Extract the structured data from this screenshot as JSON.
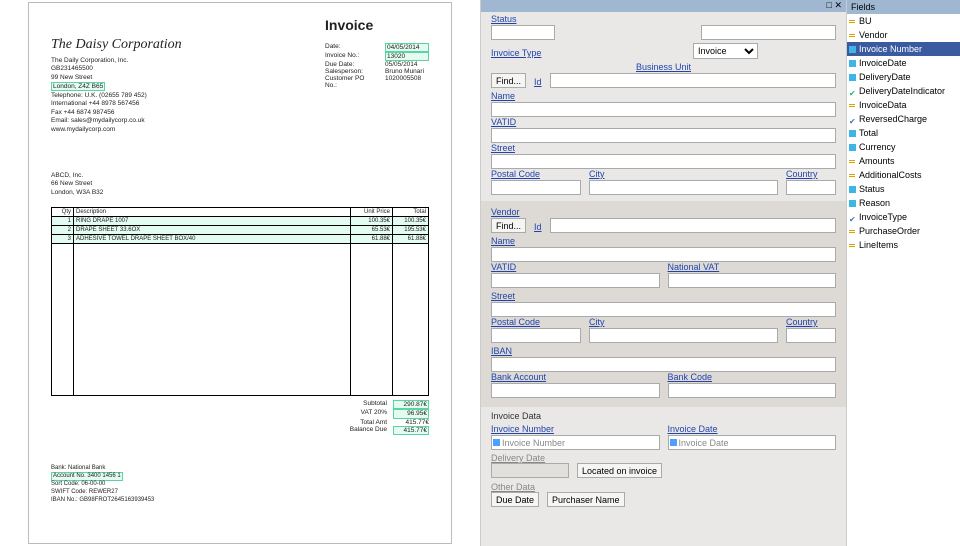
{
  "window": {
    "maximize": "□",
    "close": "✕"
  },
  "invoice": {
    "title": "Invoice",
    "corp": "The Daisy Corporation",
    "meta": {
      "date_lbl": "Date:",
      "date": "04/05/2014",
      "invno_lbl": "Invoice No.:",
      "invno": "13020",
      "due_lbl": "Due Date:",
      "due": "05/05/2014",
      "sales_lbl": "Salesperson:",
      "sales": "Bruno Munari",
      "po_lbl": "Customer PO No.:",
      "po": "1020005508"
    },
    "seller": {
      "name": "The Daily Corporation, Inc.",
      "n1": "GB231465500",
      "addr": "99 New Street",
      "city": "London, Z4Z B65",
      "tel": "Telephone: U.K. (02655 789 452)",
      "intl": "International +44 8978 567456",
      "fax": "Fax +44 6874 987456",
      "email": "Email: sales@mydailycorp.co.uk",
      "web": "www.mydailycorp.com"
    },
    "buyer": {
      "name": "ABCD, Inc.",
      "addr": "66 New Street",
      "city": "London, W3A B32"
    },
    "th": {
      "qty": "Qty",
      "desc": "Description",
      "up": "Unit Price",
      "tot": "Total"
    },
    "items": [
      {
        "q": "1",
        "d": "RING DRAPE 1007",
        "p": "100.35€",
        "t": "100.35€"
      },
      {
        "q": "2",
        "d": "DRAPE SHEET 33.6OX",
        "p": "65.53€",
        "t": "195.53€"
      },
      {
        "q": "3",
        "d": "ADHESIVE TOWEL DRAPE SHEET BOX/40",
        "p": "61.88€",
        "t": "61.88€"
      }
    ],
    "totals": {
      "subtotal_lbl": "Subtotal",
      "subtotal": "290.87€",
      "vat_lbl": "VAT 20%",
      "vat": "96.95€",
      "total_lbl": "Total Amt",
      "total": "415.77€",
      "bal_lbl": "Balance Due",
      "bal": "415.77€"
    },
    "bank": {
      "l1": "Bank: National Bank",
      "l2": "Account No. 3400 1456 1",
      "l3": "Sort Code: 06-00-00",
      "l4": "SWIFT Code: REWER27",
      "l5": "IBAN No.: GB98FROT2645163939453"
    }
  },
  "form": {
    "status": "Status",
    "invoice_type": "Invoice Type",
    "invoice_opt": "Invoice",
    "bu": "Business Unit",
    "find": "Find...",
    "id": "Id",
    "name": "Name",
    "vatid": "VATID",
    "street": "Street",
    "postal": "Postal Code",
    "city": "City",
    "country": "Country",
    "vendor": "Vendor",
    "natvat": "National VAT",
    "iban": "IBAN",
    "bankacc": "Bank Account",
    "bankcode": "Bank Code",
    "invdata": "Invoice Data",
    "invnum": "Invoice Number",
    "invdate": "Invoice Date",
    "ph_invnum": "Invoice Number",
    "ph_invdate": "Invoice Date",
    "delivdate": "Delivery Date",
    "located": "Located on invoice",
    "otherdata": "Other Data",
    "duedate": "Due Date",
    "purchaser": "Purchaser Name"
  },
  "fields": {
    "title": "Fields",
    "items": [
      {
        "i": "eq",
        "t": "BU"
      },
      {
        "i": "eq",
        "t": "Vendor"
      },
      {
        "i": "cy",
        "t": "Invoice Number",
        "sel": true
      },
      {
        "i": "cy",
        "t": "InvoiceDate"
      },
      {
        "i": "cy",
        "t": "DeliveryDate"
      },
      {
        "i": "ck",
        "t": "DeliveryDateIndicator"
      },
      {
        "i": "eq",
        "t": "InvoiceData"
      },
      {
        "i": "ckb",
        "t": "ReversedCharge"
      },
      {
        "i": "cy",
        "t": "Total"
      },
      {
        "i": "cy",
        "t": "Currency"
      },
      {
        "i": "eq",
        "t": "Amounts"
      },
      {
        "i": "eq",
        "t": "AdditionalCosts"
      },
      {
        "i": "cy",
        "t": "Status"
      },
      {
        "i": "cy",
        "t": "Reason"
      },
      {
        "i": "ckb",
        "t": "InvoiceType"
      },
      {
        "i": "eq",
        "t": "PurchaseOrder"
      },
      {
        "i": "eq",
        "t": "LineItems"
      }
    ]
  }
}
